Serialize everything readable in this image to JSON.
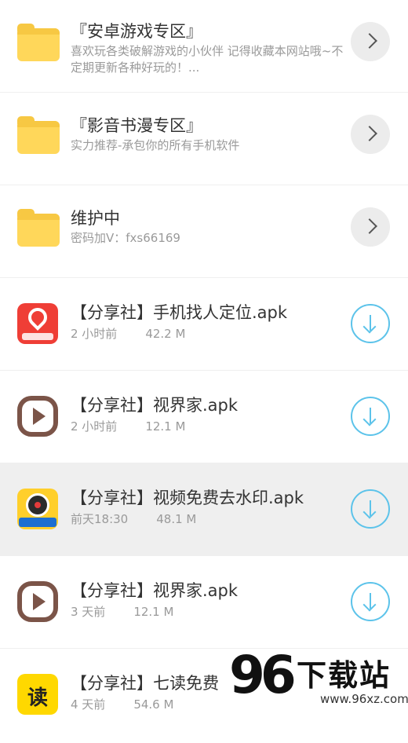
{
  "folders": [
    {
      "title": "『安卓游戏专区』",
      "desc": "喜欢玩各类破解游戏的小伙伴 记得收藏本网站哦~不定期更新各种好玩的！..."
    },
    {
      "title": "『影音书漫专区』",
      "desc": "实力推荐-承包你的所有手机软件"
    },
    {
      "title": "维护中",
      "desc": "密码加V：fxs66169"
    }
  ],
  "files": [
    {
      "name": "【分享社】手机找人定位.apk",
      "time": "2 小时前",
      "size": "42.2 M",
      "icon": "location-pin-icon"
    },
    {
      "name": "【分享社】视界家.apk",
      "time": "2 小时前",
      "size": "12.1 M",
      "icon": "play-icon"
    },
    {
      "name": "【分享社】视频免费去水印.apk",
      "time": "前天18:30",
      "size": "48.1 M",
      "icon": "camera-lens-icon"
    },
    {
      "name": "【分享社】视界家.apk",
      "time": "3 天前",
      "size": "12.1 M",
      "icon": "play-icon"
    },
    {
      "name": "【分享社】七读免费",
      "time": "4 天前",
      "size": "54.6 M",
      "icon": "read-book-icon",
      "icon_char": "读"
    }
  ],
  "watermark": {
    "brand_number": "96",
    "brand_text": "下载站",
    "url": "www.96xz.com"
  },
  "colors": {
    "accent": "#5cc3ea",
    "folder": "#ffd75a",
    "highlight": "#efefef"
  }
}
